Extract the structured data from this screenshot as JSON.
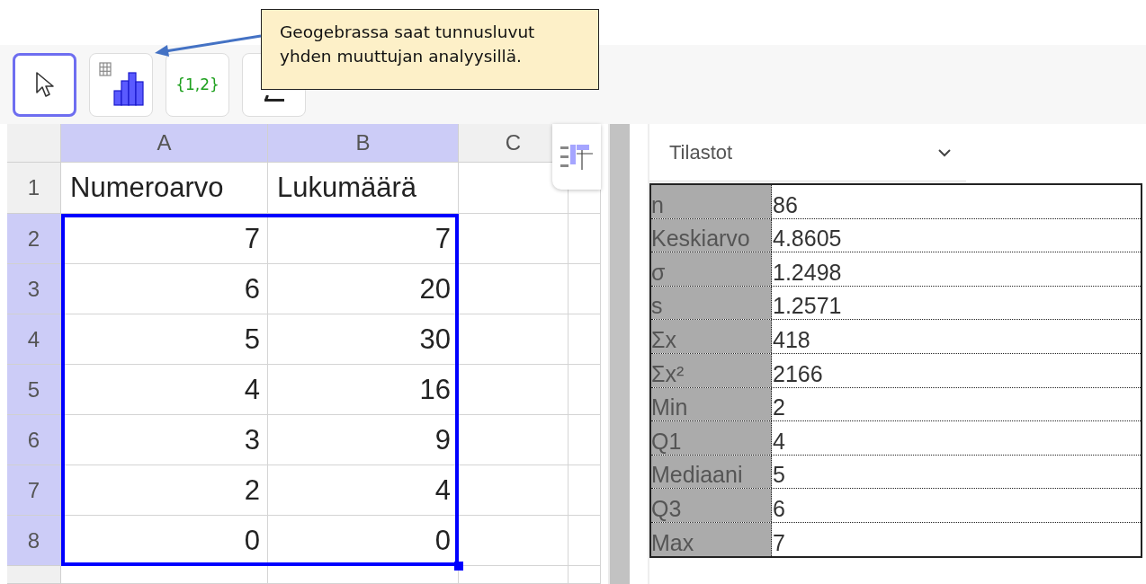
{
  "callout": {
    "text": "Geogebrassa saat tunnusluvut yhden muuttujan analyysillä."
  },
  "toolbar": [
    {
      "kind": "move",
      "selected": true
    },
    {
      "kind": "analysis",
      "selected": false
    },
    {
      "kind": "list",
      "label": "{1,2}",
      "selected": false
    },
    {
      "kind": "partial",
      "selected": false
    }
  ],
  "spreadsheet": {
    "columns": [
      {
        "label": "A",
        "selected": true
      },
      {
        "label": "B",
        "selected": true
      },
      {
        "label": "C",
        "selected": false
      }
    ],
    "rows": [
      {
        "number": "1",
        "kind": "header",
        "selected": false,
        "cells": [
          "Numeroarvo",
          "Lukumäärä"
        ]
      },
      {
        "number": "2",
        "kind": "value",
        "selected": true,
        "cells": [
          "7",
          "7"
        ]
      },
      {
        "number": "3",
        "kind": "value",
        "selected": true,
        "cells": [
          "6",
          "20"
        ]
      },
      {
        "number": "4",
        "kind": "value",
        "selected": true,
        "cells": [
          "5",
          "30"
        ]
      },
      {
        "number": "5",
        "kind": "value",
        "selected": true,
        "cells": [
          "4",
          "16"
        ]
      },
      {
        "number": "6",
        "kind": "value",
        "selected": true,
        "cells": [
          "3",
          "9"
        ]
      },
      {
        "number": "7",
        "kind": "value",
        "selected": true,
        "cells": [
          "2",
          "4"
        ]
      },
      {
        "number": "8",
        "kind": "value",
        "selected": true,
        "cells": [
          "0",
          "0"
        ]
      }
    ]
  },
  "statistics": {
    "dropdown": "Tilastot",
    "rows": [
      {
        "label": "n",
        "value": "86"
      },
      {
        "label": "Keskiarvo",
        "value": "4.8605"
      },
      {
        "label": "σ",
        "value": "1.2498"
      },
      {
        "label": "s",
        "value": "1.2571"
      },
      {
        "label": "Σx",
        "value": "418"
      },
      {
        "label": "Σx²",
        "value": "2166"
      },
      {
        "label": "Min",
        "value": "2"
      },
      {
        "label": "Q1",
        "value": "4"
      },
      {
        "label": "Mediaani",
        "value": "5"
      },
      {
        "label": "Q3",
        "value": "6"
      },
      {
        "label": "Max",
        "value": "7"
      }
    ]
  }
}
